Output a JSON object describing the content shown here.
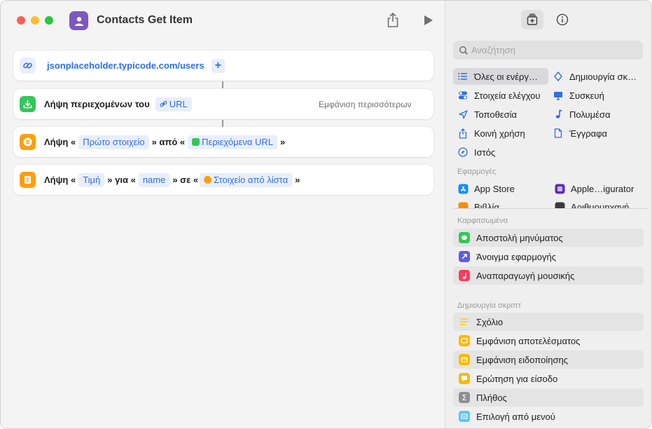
{
  "window": {
    "title": "Contacts Get Item"
  },
  "workflow": {
    "row1": {
      "url": "jsonplaceholder.typicode.com/users"
    },
    "row2": {
      "label": "Λήψη περιεχομένων του",
      "token": "URL",
      "show_more": "Εμφάνιση περισσότερων"
    },
    "row3": {
      "prefix": "Λήψη «",
      "token1": "Πρώτο στοιχείο",
      "middle": "» από «",
      "token2": "Περιεχόμενα URL",
      "suffix": "»"
    },
    "row4": {
      "prefix": "Λήψη «",
      "token1": "Τιμή",
      "mid1": "» για «",
      "token2": "name",
      "mid2": "» σε «",
      "token3": "Στοιχείο από λίστα",
      "suffix": "»"
    }
  },
  "sidebar": {
    "search_placeholder": "Αναζήτηση",
    "categories": [
      {
        "label": "Όλες οι ενέργ…",
        "icon": "list-icon"
      },
      {
        "label": "Δημιουργία σκ…",
        "icon": "scripting-icon"
      },
      {
        "label": "Στοιχεία ελέγχου",
        "icon": "toggle-icon"
      },
      {
        "label": "Συσκευή",
        "icon": "display-icon"
      },
      {
        "label": "Τοποθεσία",
        "icon": "location-icon"
      },
      {
        "label": "Πολυμέσα",
        "icon": "music-note-icon"
      },
      {
        "label": "Κοινή χρήση",
        "icon": "share-icon"
      },
      {
        "label": "Έγγραφα",
        "icon": "document-icon"
      },
      {
        "label": "Ιστός",
        "icon": "compass-icon"
      }
    ],
    "apps_label": "Εφαρμογές",
    "apps": [
      {
        "label": "App Store"
      },
      {
        "label": "Apple…igurator"
      },
      {
        "label": "Βιβλία"
      },
      {
        "label": "Αριθμομηχανή"
      }
    ],
    "pinned_label": "Καρφιτσωμένα",
    "pinned": [
      {
        "label": "Αποστολή μηνύματος",
        "color": "#34c759"
      },
      {
        "label": "Άνοιγμα εφαρμογής",
        "color": "#5e5ce6"
      },
      {
        "label": "Αναπαραγωγή μουσικής",
        "color": "#ff3b5c"
      }
    ],
    "scripting_label": "Δημιουργία σκριπτ",
    "scripting": [
      {
        "label": "Σχόλιο",
        "color": "#ffd60a"
      },
      {
        "label": "Εμφάνιση αποτελέσματος",
        "color": "#ffb800"
      },
      {
        "label": "Εμφάνιση ειδοποίησης",
        "color": "#ffb800"
      },
      {
        "label": "Ερώτηση για είσοδο",
        "color": "#ffb800"
      },
      {
        "label": "Πλήθος",
        "color": "#8e8e93"
      },
      {
        "label": "Επιλογή από μενού",
        "color": "#5ac8fa"
      }
    ]
  }
}
